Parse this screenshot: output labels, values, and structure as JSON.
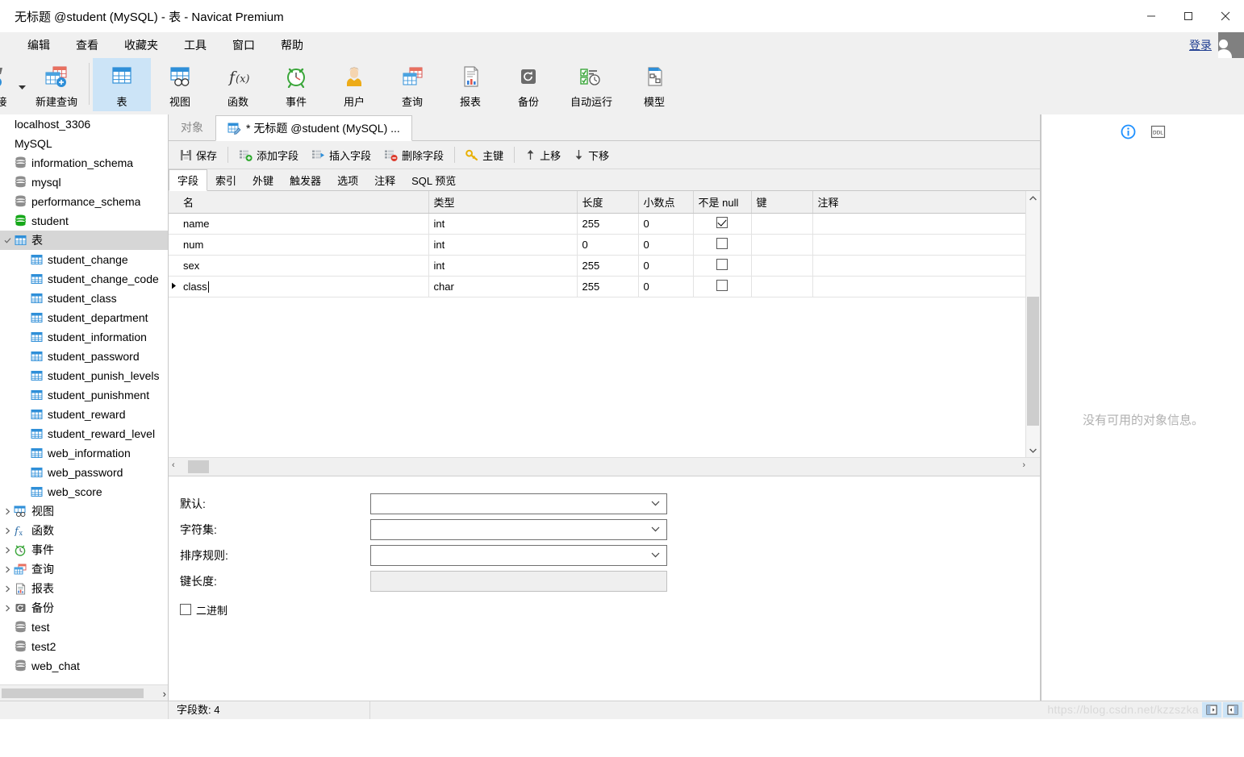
{
  "window": {
    "title": "无标题 @student (MySQL) - 表 - Navicat Premium",
    "minimize": "−",
    "maximize": "□",
    "close": "✕"
  },
  "menubar": {
    "items": [
      "编辑",
      "查看",
      "收藏夹",
      "工具",
      "窗口",
      "帮助"
    ],
    "login_label": "登录"
  },
  "toolbar": {
    "items": [
      {
        "label": "接",
        "icon": "connection-icon"
      },
      {
        "label": "新建查询",
        "icon": "new-query-icon"
      },
      {
        "label": "表",
        "icon": "table-icon",
        "active": true
      },
      {
        "label": "视图",
        "icon": "view-icon"
      },
      {
        "label": "函数",
        "icon": "function-icon"
      },
      {
        "label": "事件",
        "icon": "event-icon"
      },
      {
        "label": "用户",
        "icon": "user-icon"
      },
      {
        "label": "查询",
        "icon": "query-icon"
      },
      {
        "label": "报表",
        "icon": "report-icon"
      },
      {
        "label": "备份",
        "icon": "backup-icon"
      },
      {
        "label": "自动运行",
        "icon": "automation-icon"
      },
      {
        "label": "模型",
        "icon": "model-icon"
      }
    ]
  },
  "sidebar": {
    "nodes": [
      {
        "label": "localhost_3306",
        "indent": 0,
        "icon": "none",
        "arrow": "",
        "selected": false
      },
      {
        "label": "MySQL",
        "indent": 0,
        "icon": "none",
        "arrow": "",
        "selected": false
      },
      {
        "label": "information_schema",
        "indent": 0,
        "icon": "db-gray",
        "arrow": "",
        "selected": false
      },
      {
        "label": "mysql",
        "indent": 0,
        "icon": "db-gray",
        "arrow": "",
        "selected": false
      },
      {
        "label": "performance_schema",
        "indent": 0,
        "icon": "db-gray",
        "arrow": "",
        "selected": false
      },
      {
        "label": "student",
        "indent": 0,
        "icon": "db-green",
        "arrow": "",
        "selected": false
      },
      {
        "label": "表",
        "indent": 1,
        "icon": "table",
        "arrow": "v",
        "selected": true
      },
      {
        "label": "student_change",
        "indent": 2,
        "icon": "table",
        "arrow": "",
        "selected": false
      },
      {
        "label": "student_change_code",
        "indent": 2,
        "icon": "table",
        "arrow": "",
        "selected": false
      },
      {
        "label": "student_class",
        "indent": 2,
        "icon": "table",
        "arrow": "",
        "selected": false
      },
      {
        "label": "student_department",
        "indent": 2,
        "icon": "table",
        "arrow": "",
        "selected": false
      },
      {
        "label": "student_information",
        "indent": 2,
        "icon": "table",
        "arrow": "",
        "selected": false
      },
      {
        "label": "student_password",
        "indent": 2,
        "icon": "table",
        "arrow": "",
        "selected": false
      },
      {
        "label": "student_punish_levels",
        "indent": 2,
        "icon": "table",
        "arrow": "",
        "selected": false
      },
      {
        "label": "student_punishment",
        "indent": 2,
        "icon": "table",
        "arrow": "",
        "selected": false
      },
      {
        "label": "student_reward",
        "indent": 2,
        "icon": "table",
        "arrow": "",
        "selected": false
      },
      {
        "label": "student_reward_level",
        "indent": 2,
        "icon": "table",
        "arrow": "",
        "selected": false
      },
      {
        "label": "web_information",
        "indent": 2,
        "icon": "table",
        "arrow": "",
        "selected": false
      },
      {
        "label": "web_password",
        "indent": 2,
        "icon": "table",
        "arrow": "",
        "selected": false
      },
      {
        "label": "web_score",
        "indent": 2,
        "icon": "table",
        "arrow": "",
        "selected": false
      },
      {
        "label": "视图",
        "indent": 1,
        "icon": "view",
        "arrow": ">",
        "selected": false
      },
      {
        "label": "函数",
        "indent": 1,
        "icon": "function",
        "arrow": ">",
        "selected": false
      },
      {
        "label": "事件",
        "indent": 1,
        "icon": "event",
        "arrow": ">",
        "selected": false
      },
      {
        "label": "查询",
        "indent": 1,
        "icon": "query",
        "arrow": ">",
        "selected": false
      },
      {
        "label": "报表",
        "indent": 1,
        "icon": "report",
        "arrow": ">",
        "selected": false
      },
      {
        "label": "备份",
        "indent": 1,
        "icon": "backup",
        "arrow": ">",
        "selected": false
      },
      {
        "label": "test",
        "indent": 0,
        "icon": "db-gray",
        "arrow": "",
        "selected": false
      },
      {
        "label": "test2",
        "indent": 0,
        "icon": "db-gray",
        "arrow": "",
        "selected": false
      },
      {
        "label": "web_chat",
        "indent": 0,
        "icon": "db-gray",
        "arrow": "",
        "selected": false
      }
    ],
    "hscroll_arrow": "›"
  },
  "editor": {
    "tabs": [
      {
        "label": "对象",
        "active": false,
        "icon": "none"
      },
      {
        "label": "* 无标题 @student (MySQL) ...",
        "active": true,
        "icon": "table-edit-icon"
      }
    ],
    "actions": [
      {
        "label": "保存",
        "icon": "save-icon"
      },
      {
        "label": "添加字段",
        "icon": "add-field-icon"
      },
      {
        "label": "插入字段",
        "icon": "insert-field-icon"
      },
      {
        "label": "删除字段",
        "icon": "delete-field-icon"
      },
      {
        "label": "主键",
        "icon": "primary-key-icon"
      },
      {
        "label": "上移",
        "icon": "move-up-icon"
      },
      {
        "label": "下移",
        "icon": "move-down-icon"
      }
    ],
    "subtabs": [
      {
        "label": "字段",
        "active": true
      },
      {
        "label": "索引",
        "active": false
      },
      {
        "label": "外键",
        "active": false
      },
      {
        "label": "触发器",
        "active": false
      },
      {
        "label": "选项",
        "active": false
      },
      {
        "label": "注释",
        "active": false
      },
      {
        "label": "SQL 预览",
        "active": false
      }
    ],
    "grid": {
      "columns": [
        "名",
        "类型",
        "长度",
        "小数点",
        "不是 null",
        "键",
        "注释"
      ],
      "rows": [
        {
          "name": "name",
          "type": "int",
          "length": "255",
          "decimals": "0",
          "notnull": true,
          "key": "",
          "comment": "",
          "current": false
        },
        {
          "name": "num",
          "type": "int",
          "length": "0",
          "decimals": "0",
          "notnull": false,
          "key": "",
          "comment": "",
          "current": false
        },
        {
          "name": "sex",
          "type": "int",
          "length": "255",
          "decimals": "0",
          "notnull": false,
          "key": "",
          "comment": "",
          "current": false
        },
        {
          "name": "class",
          "type": "char",
          "length": "255",
          "decimals": "0",
          "notnull": false,
          "key": "",
          "comment": "",
          "current": true
        }
      ]
    },
    "properties": [
      {
        "label": "默认:",
        "value": "",
        "type": "select"
      },
      {
        "label": "字符集:",
        "value": "",
        "type": "select"
      },
      {
        "label": "排序规则:",
        "value": "",
        "type": "select"
      },
      {
        "label": "键长度:",
        "value": "",
        "type": "readonly"
      }
    ],
    "binary_checkbox": {
      "label": "二进制",
      "checked": false
    }
  },
  "rightpanel": {
    "info_icon": "info-icon",
    "ddl_icon": "ddl-icon",
    "empty_message": "没有可用的对象信息。"
  },
  "statusbar": {
    "field_count": "字段数: 4",
    "watermark": "https://blog.csdn.net/kzzszka"
  }
}
